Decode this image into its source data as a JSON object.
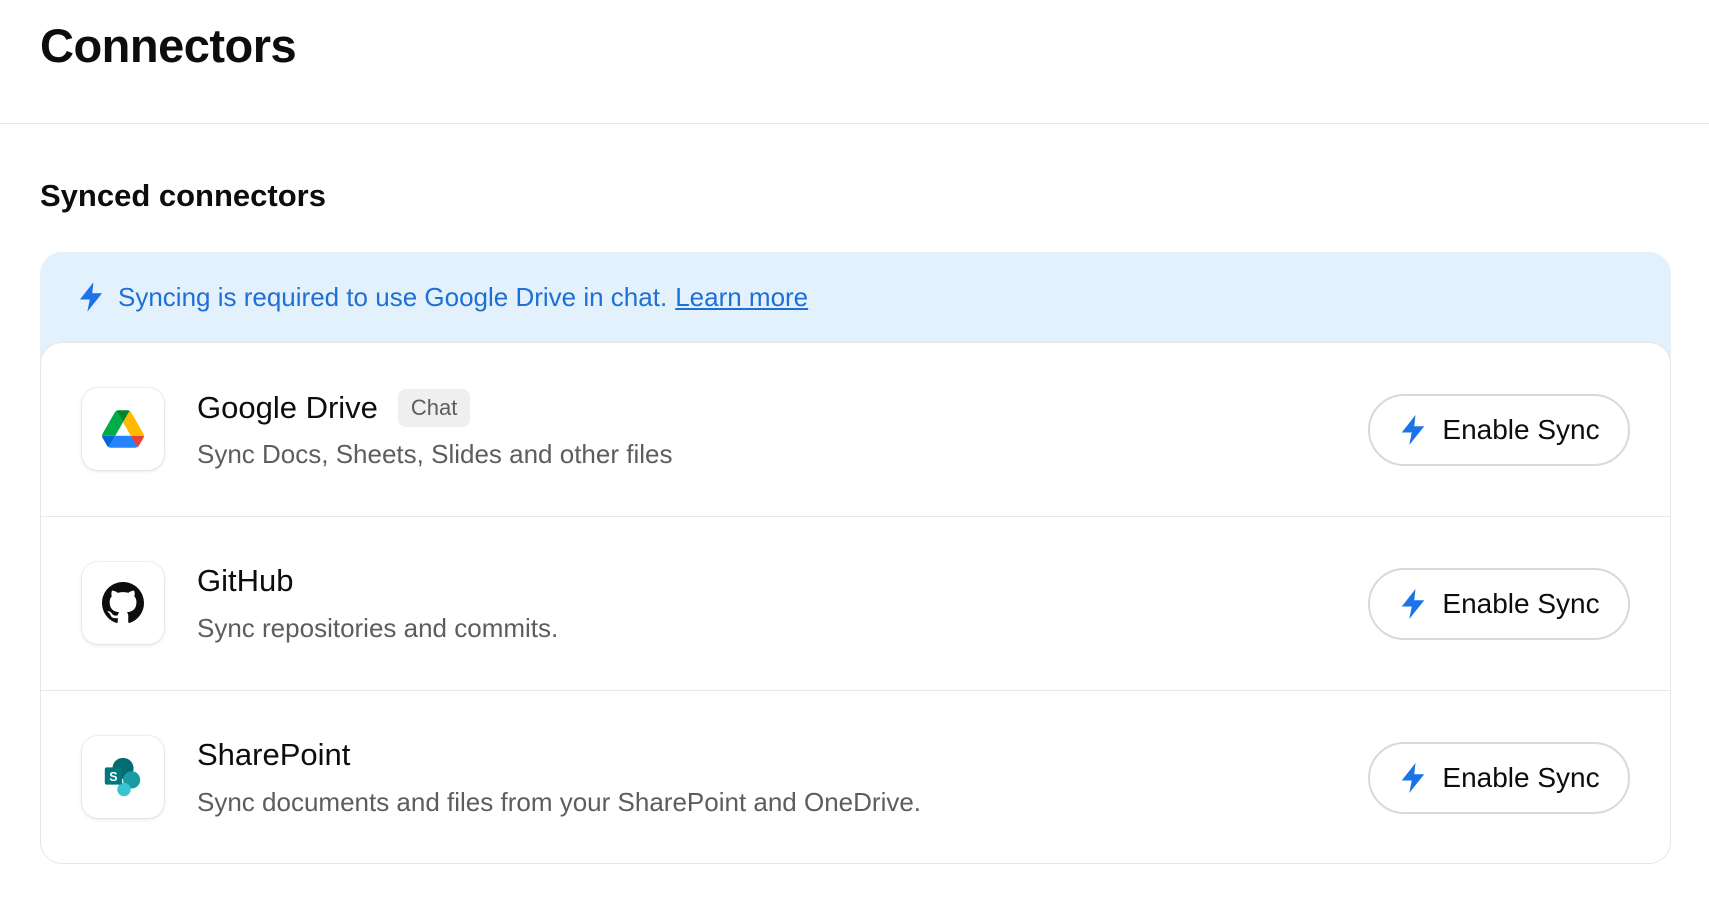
{
  "header": {
    "title": "Connectors"
  },
  "section": {
    "title": "Synced connectors"
  },
  "notice": {
    "text": "Syncing is required to use Google Drive in chat.",
    "link_label": "Learn more"
  },
  "connectors": [
    {
      "name": "Google Drive",
      "badge": "Chat",
      "description": "Sync Docs, Sheets, Slides and other files",
      "button_label": "Enable Sync",
      "icon": "google-drive-icon"
    },
    {
      "name": "GitHub",
      "description": "Sync repositories and commits.",
      "button_label": "Enable Sync",
      "icon": "github-icon"
    },
    {
      "name": "SharePoint",
      "description": "Sync documents and files from your SharePoint and OneDrive.",
      "button_label": "Enable Sync",
      "icon": "sharepoint-icon"
    }
  ],
  "colors": {
    "accent": "#1e6fd6",
    "notice_bg": "#e3f1fc",
    "bolt": "#1a73e8"
  }
}
